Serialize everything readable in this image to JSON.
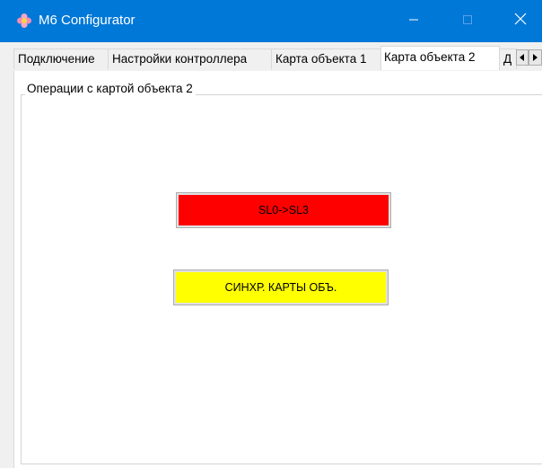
{
  "window": {
    "title": "M6 Configurator",
    "app_icon": "flower-icon",
    "controls": {
      "minimize": "minimize-icon",
      "maximize": "maximize-icon",
      "close": "close-icon"
    },
    "accent_color": "#0078d7"
  },
  "tabs": [
    {
      "label": "Подключение",
      "selected": false
    },
    {
      "label": "Настройки контроллера",
      "selected": false
    },
    {
      "label": "Карта объекта 1",
      "selected": false
    },
    {
      "label": "Карта объекта 2",
      "selected": true
    },
    {
      "label": "Д",
      "selected": false
    }
  ],
  "tab_scroll": {
    "left_icon": "scroll-left-icon",
    "right_icon": "scroll-right-icon"
  },
  "group": {
    "title": "Операции с картой объекта 2",
    "buttons": [
      {
        "label": "SL0->SL3",
        "color": "#ff0000"
      },
      {
        "label": "СИНХР. КАРТЫ ОБЪ.",
        "color": "#ffff00"
      }
    ]
  }
}
